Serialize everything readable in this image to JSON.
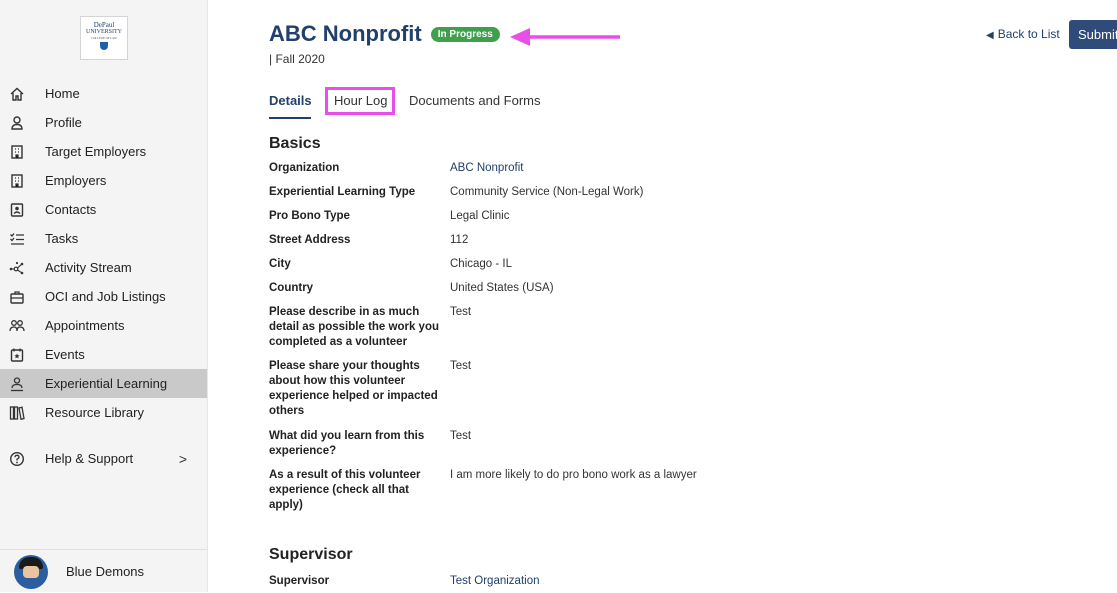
{
  "sidebar": {
    "logo_lines": [
      "DePaul",
      "UNIVERSITY",
      "COLLEGE OF LAW"
    ],
    "items": [
      {
        "label": "Home",
        "icon": "home-icon"
      },
      {
        "label": "Profile",
        "icon": "profile-icon"
      },
      {
        "label": "Target Employers",
        "icon": "building-icon"
      },
      {
        "label": "Employers",
        "icon": "building-icon"
      },
      {
        "label": "Contacts",
        "icon": "contact-card-icon"
      },
      {
        "label": "Tasks",
        "icon": "checklist-icon"
      },
      {
        "label": "Activity Stream",
        "icon": "network-icon"
      },
      {
        "label": "OCI and Job Listings",
        "icon": "briefcase-icon"
      },
      {
        "label": "Appointments",
        "icon": "people-icon"
      },
      {
        "label": "Events",
        "icon": "calendar-star-icon"
      },
      {
        "label": "Experiential Learning",
        "icon": "learner-icon",
        "active": true
      },
      {
        "label": "Resource Library",
        "icon": "library-icon"
      },
      {
        "label": "Help & Support",
        "icon": "help-icon",
        "chevron": ">"
      }
    ],
    "user_name": "Blue Demons"
  },
  "header": {
    "title": "ABC Nonprofit",
    "status_badge": "In Progress",
    "subtitle": "| Fall 2020",
    "back_link": "Back to List",
    "back_icon": "chevron-left-icon",
    "submit_label": "Submit"
  },
  "tabs": [
    {
      "label": "Details",
      "active": true
    },
    {
      "label": "Hour Log",
      "highlighted": true
    },
    {
      "label": "Documents and Forms"
    }
  ],
  "basics": {
    "title": "Basics",
    "fields": [
      {
        "label": "Organization",
        "value": "ABC Nonprofit",
        "link": true
      },
      {
        "label": "Experiential Learning Type",
        "value": "Community Service (Non-Legal Work)"
      },
      {
        "label": "Pro Bono Type",
        "value": "Legal Clinic"
      },
      {
        "label": "Street Address",
        "value": "112"
      },
      {
        "label": "City",
        "value": "Chicago - IL"
      },
      {
        "label": "Country",
        "value": "United States (USA)"
      },
      {
        "label": "Please describe in as much detail as possible the work you completed as a volunteer",
        "value": "Test"
      },
      {
        "label": "Please share your thoughts about how this volunteer experience helped or impacted others",
        "value": "Test"
      },
      {
        "label": "What did you learn from this experience?",
        "value": "Test"
      },
      {
        "label": "As a result of this volunteer experience (check all that apply)",
        "value": "I am more likely to do pro bono work as a lawyer"
      }
    ]
  },
  "supervisor": {
    "title": "Supervisor",
    "fields": [
      {
        "label": "Supervisor",
        "value": "Test Organization",
        "link": true
      }
    ]
  },
  "colors": {
    "brand_navy": "#21406b",
    "badge_green": "#3f9f4a",
    "annotation_magenta": "#e84fe8",
    "active_nav_bg": "#c9c9c9"
  }
}
